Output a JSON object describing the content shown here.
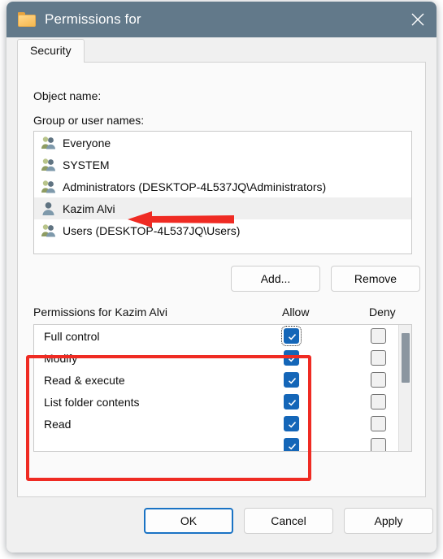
{
  "window": {
    "title": "Permissions for ",
    "folder_icon": "folder-icon",
    "close_icon": "close-icon"
  },
  "tabs": [
    {
      "label": "Security",
      "selected": true
    }
  ],
  "labels": {
    "object_name": "Object name:",
    "object_name_value": "",
    "group_or_user_names": "Group or user names:",
    "permissions_for": "Permissions for Kazim Alvi",
    "allow": "Allow",
    "deny": "Deny"
  },
  "group_list": {
    "items": [
      {
        "name": "Everyone",
        "icon": "group-icon",
        "selected": false
      },
      {
        "name": "SYSTEM",
        "icon": "group-icon",
        "selected": false
      },
      {
        "name": "Administrators (DESKTOP-4L537JQ\\Administrators)",
        "icon": "group-icon",
        "selected": false
      },
      {
        "name": "Kazim Alvi",
        "icon": "user-icon",
        "selected": true
      },
      {
        "name": "Users (DESKTOP-4L537JQ\\Users)",
        "icon": "group-icon",
        "selected": false
      }
    ]
  },
  "list_buttons": {
    "add": "Add...",
    "remove": "Remove"
  },
  "permissions": {
    "rows": [
      {
        "name": "Full control",
        "allow": true,
        "deny": false,
        "focused": true
      },
      {
        "name": "Modify",
        "allow": true,
        "deny": false,
        "focused": false
      },
      {
        "name": "Read & execute",
        "allow": true,
        "deny": false,
        "focused": false
      },
      {
        "name": "List folder contents",
        "allow": true,
        "deny": false,
        "focused": false
      },
      {
        "name": "Read",
        "allow": true,
        "deny": false,
        "focused": false
      },
      {
        "name": "",
        "allow": true,
        "deny": false,
        "focused": false
      }
    ],
    "scrollbar": {
      "visible": true,
      "thumb_position": "top"
    }
  },
  "footer_buttons": {
    "ok": "OK",
    "cancel": "Cancel",
    "apply": "Apply"
  },
  "annotations": {
    "highlight_rect_color": "#ef2b23",
    "arrow_color": "#ef2b23",
    "arrow_target": "Kazim Alvi"
  },
  "colors": {
    "titlebar": "#62798a",
    "accent_checkbox": "#1466b8",
    "default_button_border": "#1a73c4",
    "annotation_red": "#ef2b23"
  }
}
